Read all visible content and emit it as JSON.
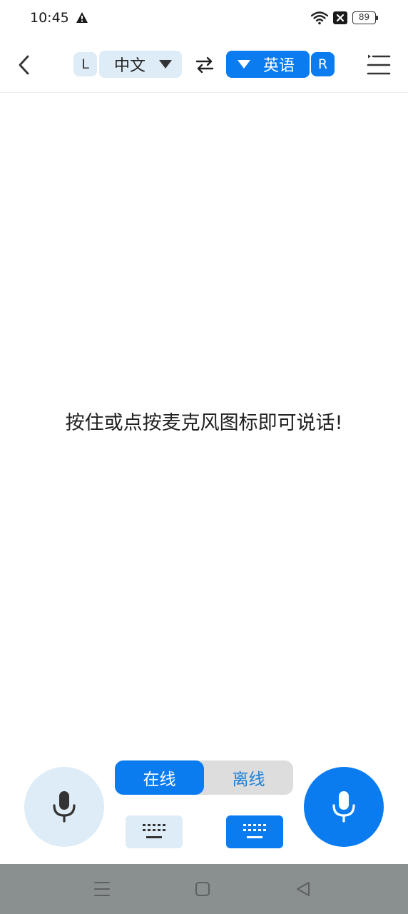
{
  "status_bar": {
    "time": "10:45",
    "battery": "89",
    "icons": [
      "warning-icon",
      "wifi-icon",
      "no-sim-icon",
      "battery-icon"
    ]
  },
  "top_bar": {
    "left_tag": "L",
    "right_tag": "R",
    "source_language": "中文",
    "target_language": "英语",
    "icons": [
      "back-arrow-icon",
      "swap-icon",
      "menu-icon",
      "caret-down-icon"
    ]
  },
  "content": {
    "hint": "按住或点按麦克风图标即可说话!"
  },
  "controls": {
    "mode_online": "在线",
    "mode_offline": "离线",
    "selected_mode": "在线",
    "icons": [
      "microphone-icon",
      "keyboard-icon"
    ]
  },
  "nav_bar": {
    "icons": [
      "menu-icon",
      "home-icon",
      "back-icon"
    ]
  },
  "colors": {
    "accent": "#0a7cf0",
    "accent_light": "#deecf7",
    "nav_background": "#8a8f8f"
  }
}
